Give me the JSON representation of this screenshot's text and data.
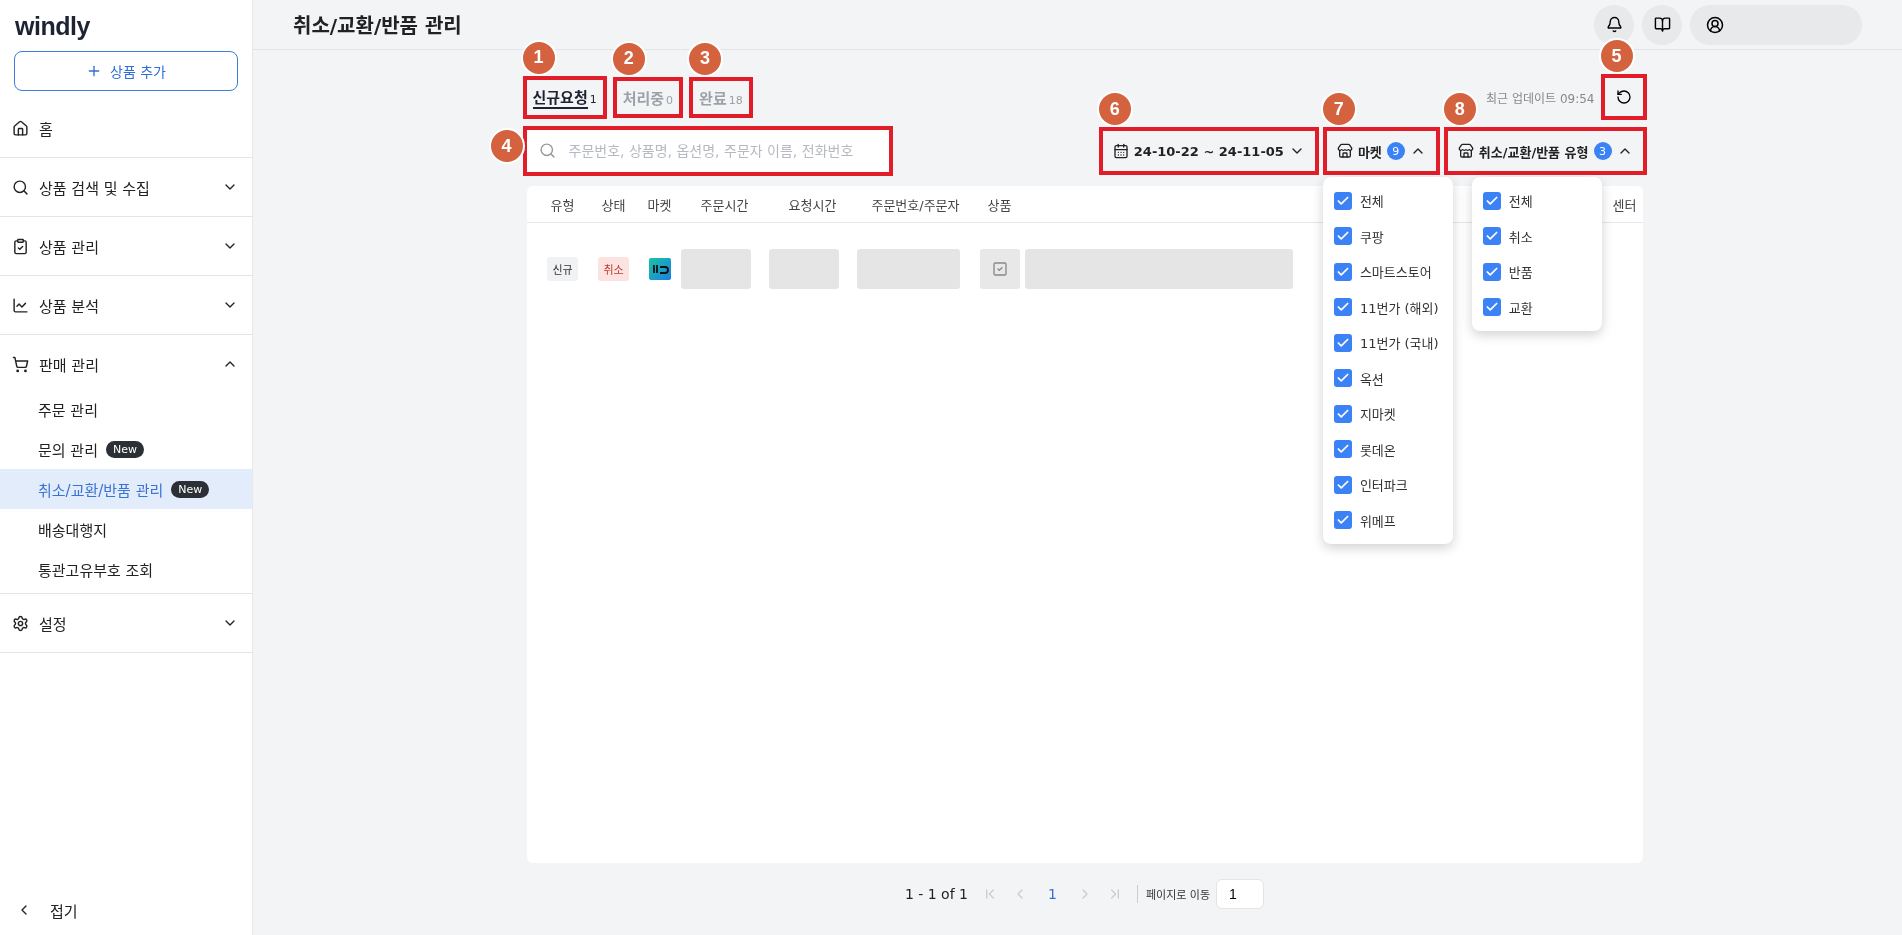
{
  "brand": "windly",
  "add_button": {
    "label": "상품 추가"
  },
  "nav": [
    {
      "kind": "link",
      "label": "홈"
    },
    {
      "kind": "group",
      "label": "상품 검색 및 수집",
      "expanded": false
    },
    {
      "kind": "group",
      "label": "상품 관리",
      "expanded": false
    },
    {
      "kind": "group",
      "label": "상품 분석",
      "expanded": false
    },
    {
      "kind": "group",
      "label": "판매 관리",
      "expanded": true,
      "children": [
        {
          "label": "주문 관리",
          "selected": false
        },
        {
          "label": "문의 관리",
          "badge": "New",
          "selected": false
        },
        {
          "label": "취소/교환/반품 관리",
          "badge": "New",
          "selected": true
        },
        {
          "label": "배송대행지",
          "selected": false
        },
        {
          "label": "통관고유부호 조회",
          "selected": false
        }
      ]
    },
    {
      "kind": "group",
      "label": "설정",
      "expanded": false
    }
  ],
  "collapse": {
    "label": "접기"
  },
  "page_title": "취소/교환/반품 관리",
  "tabs": [
    {
      "label": "신규요청",
      "count": "1",
      "selected": true,
      "callout": "1"
    },
    {
      "label": "처리중",
      "count": "0",
      "selected": false,
      "callout": "2"
    },
    {
      "label": "완료",
      "count": "18",
      "selected": false,
      "callout": "3"
    }
  ],
  "last_update": "최근 업데이트 09:54",
  "refresh": {
    "callout": "5"
  },
  "search": {
    "placeholder": "주문번호, 상품명, 옵션명, 주문자 이름, 전화번호",
    "callout": "4"
  },
  "date_filter": {
    "label": "24-10-22 ~ 24-11-05",
    "expanded": false,
    "callout": "6"
  },
  "market_filter": {
    "label": "마켓",
    "count": "9",
    "expanded": true,
    "callout": "7",
    "options": [
      {
        "label": "전체",
        "checked": true
      },
      {
        "label": "쿠팡",
        "checked": true
      },
      {
        "label": "스마트스토어",
        "checked": true
      },
      {
        "label": "11번가 (해외)",
        "checked": true
      },
      {
        "label": "11번가 (국내)",
        "checked": true
      },
      {
        "label": "옥션",
        "checked": true
      },
      {
        "label": "지마켓",
        "checked": true
      },
      {
        "label": "롯데온",
        "checked": true
      },
      {
        "label": "인터파크",
        "checked": true
      },
      {
        "label": "위메프",
        "checked": true
      }
    ]
  },
  "type_filter": {
    "label": "취소/교환/반품 유형",
    "count": "3",
    "expanded": true,
    "callout": "8",
    "options": [
      {
        "label": "전체",
        "checked": true
      },
      {
        "label": "취소",
        "checked": true
      },
      {
        "label": "반품",
        "checked": true
      },
      {
        "label": "교환",
        "checked": true
      }
    ]
  },
  "table": {
    "columns": [
      "유형",
      "상태",
      "마켓",
      "주문시간",
      "요청시간",
      "주문번호/주문자",
      "상품"
    ],
    "column_8": "센터",
    "rows": [
      {
        "type": "신규",
        "status": "취소"
      }
    ]
  },
  "pagination": {
    "range": "1 - 1 of 1",
    "pages": [
      {
        "label": "1",
        "selected": true
      }
    ],
    "goto_label": "페이지로 이동",
    "goto_value": "1"
  }
}
